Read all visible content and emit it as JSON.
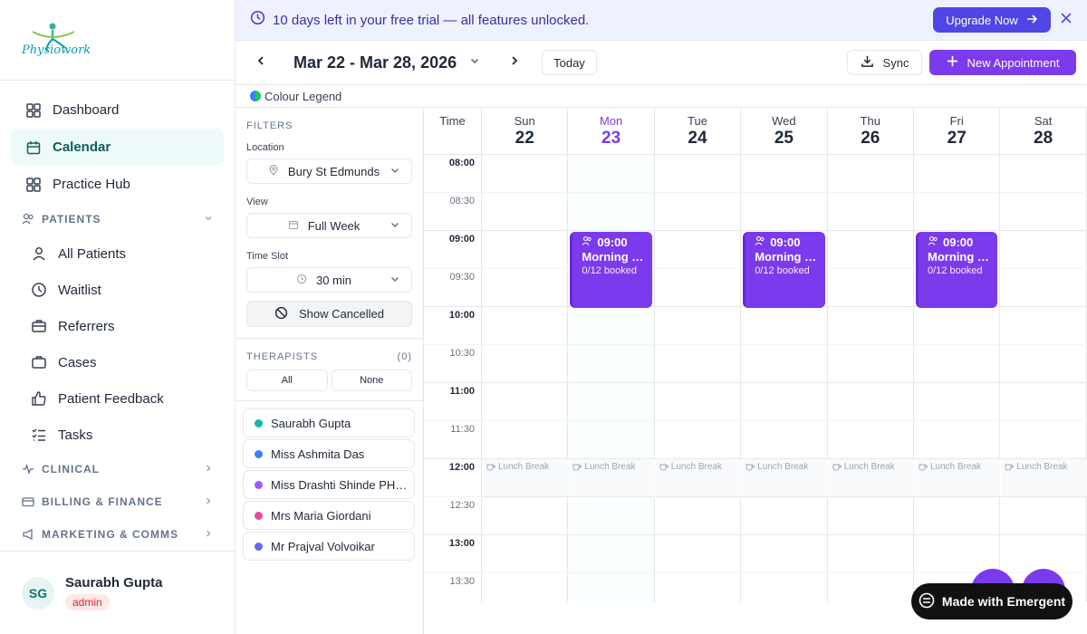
{
  "brand": {
    "name": "Physiowork"
  },
  "sidebar": {
    "main_items": [
      {
        "label": "Dashboard",
        "icon": "dashboard-icon"
      },
      {
        "label": "Calendar",
        "icon": "calendar-icon",
        "active": true
      },
      {
        "label": "Practice Hub",
        "icon": "grid-icon"
      }
    ],
    "patients_section": "PATIENTS",
    "patients_items": [
      {
        "label": "All Patients",
        "icon": "user-icon"
      },
      {
        "label": "Waitlist",
        "icon": "clock-icon"
      },
      {
        "label": "Referrers",
        "icon": "briefcase-icon"
      },
      {
        "label": "Cases",
        "icon": "case-icon"
      },
      {
        "label": "Patient Feedback",
        "icon": "thumbs-up-icon"
      },
      {
        "label": "Tasks",
        "icon": "tasks-icon"
      }
    ],
    "clinical_section": "CLINICAL",
    "billing_section": "BILLING & FINANCE",
    "marketing_section": "MARKETING & COMMS",
    "user": {
      "initials": "SG",
      "name": "Saurabh Gupta",
      "role": "admin"
    }
  },
  "banner": {
    "text": "10 days left in your free trial — all features unlocked.",
    "upgrade_label": "Upgrade Now"
  },
  "toolbar": {
    "date_range": "Mar 22 - Mar 28, 2026",
    "today_label": "Today",
    "sync_label": "Sync",
    "new_appointment_label": "New Appointment"
  },
  "legend_label": "Colour Legend",
  "filters": {
    "title": "FILTERS",
    "location_label": "Location",
    "location_value": "Bury St Edmunds",
    "view_label": "View",
    "view_value": "Full Week",
    "timeslot_label": "Time Slot",
    "timeslot_value": "30 min",
    "show_cancelled_label": "Show Cancelled",
    "therapists_title": "THERAPISTS",
    "therapists_count": "(0)",
    "all_label": "All",
    "none_label": "None",
    "therapists": [
      {
        "name": "Saurabh Gupta",
        "color": "#14b8a6"
      },
      {
        "name": "Miss Ashmita Das",
        "color": "#3b82f6"
      },
      {
        "name": "Miss Drashti Shinde PH…",
        "color": "#a855f7"
      },
      {
        "name": "Mrs Maria Giordani",
        "color": "#ec4899"
      },
      {
        "name": "Mr Prajval Volvoikar",
        "color": "#6366f1"
      }
    ]
  },
  "calendar": {
    "time_header": "Time",
    "days": [
      {
        "name": "Sun",
        "date": "22"
      },
      {
        "name": "Mon",
        "date": "23",
        "today": true
      },
      {
        "name": "Tue",
        "date": "24"
      },
      {
        "name": "Wed",
        "date": "25"
      },
      {
        "name": "Thu",
        "date": "26"
      },
      {
        "name": "Fri",
        "date": "27"
      },
      {
        "name": "Sat",
        "date": "28"
      }
    ],
    "times": [
      "08:00",
      "08:30",
      "09:00",
      "09:30",
      "10:00",
      "10:30",
      "11:00",
      "11:30",
      "12:00",
      "12:30",
      "13:00",
      "13:30"
    ],
    "lunch_label": "Lunch Break",
    "lunch_time": "12:00",
    "events": [
      {
        "day": "Mon",
        "time": "09:00",
        "title": "Morning Pi…",
        "booked": "0/12 booked"
      },
      {
        "day": "Wed",
        "time": "09:00",
        "title": "Morning Pi…",
        "booked": "0/12 booked"
      },
      {
        "day": "Fri",
        "time": "09:00",
        "title": "Morning Pi…",
        "booked": "0/12 booked"
      }
    ]
  },
  "emergent_label": "Made with Emergent"
}
